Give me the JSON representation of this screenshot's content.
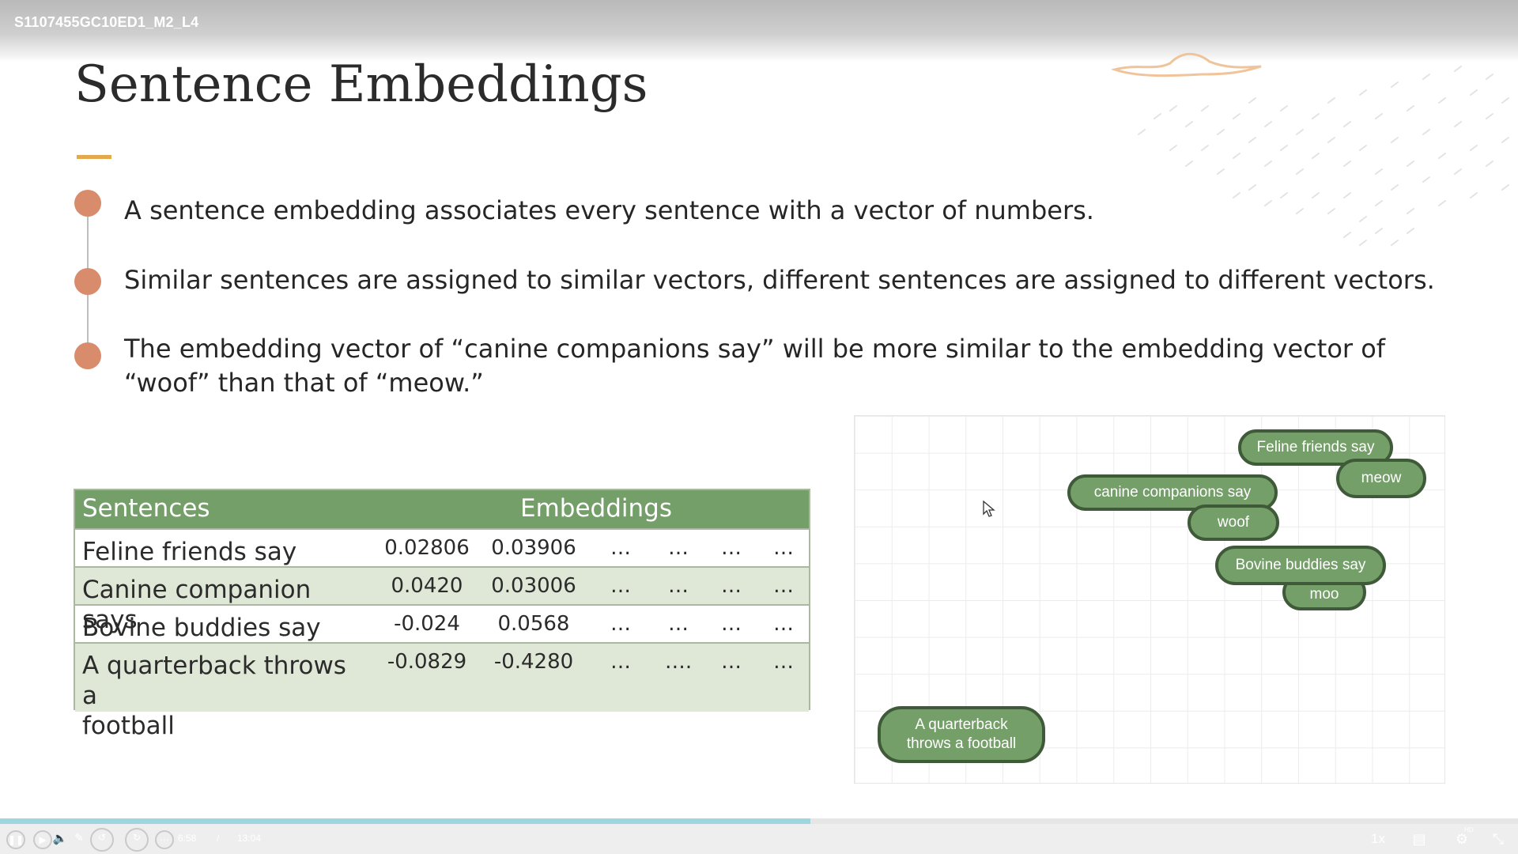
{
  "header": {
    "course_id": "S1107455GC10ED1_M2_L4"
  },
  "slide": {
    "title": "Sentence Embeddings",
    "bullets": [
      {
        "text": "A sentence embedding associates every sentence with a vector of numbers."
      },
      {
        "text": "Similar sentences are assigned to similar vectors, different sentences are assigned to different vectors."
      },
      {
        "line1": "The embedding vector of “canine companions say” will be more similar to the embedding vector of",
        "line2": "“woof” than that of “meow.”"
      }
    ],
    "table": {
      "headers": [
        "Sentences",
        "Embeddings"
      ],
      "rows": [
        {
          "sentence": "Feline friends say",
          "values": [
            "0.02806",
            "0.03906",
            "…",
            "…",
            "…",
            "…"
          ]
        },
        {
          "sentence": "Canine companion says",
          "values": [
            "0.0420",
            "0.03006",
            "…",
            "…",
            "…",
            "…"
          ]
        },
        {
          "sentence": "Bovine buddies say",
          "values": [
            "-0.024",
            "0.0568",
            "…",
            "…",
            "…",
            "…"
          ]
        },
        {
          "sentence_line1": "A quarterback throws a",
          "sentence_line2": "football",
          "values": [
            "-0.0829",
            "-0.4280",
            "…",
            "….",
            "…",
            "…"
          ]
        }
      ]
    },
    "plot": {
      "labels": {
        "feline": "Feline friends say",
        "meow": "meow",
        "canine": "canine companions say",
        "woof": "woof",
        "bovine": "Bovine buddies say",
        "moo": "moo",
        "quarterback_line1": "A quarterback",
        "quarterback_line2": "throws a football"
      },
      "pill_color": "#749f69",
      "pill_border": "#3f5a39"
    }
  },
  "player": {
    "current_time": "6:58",
    "separator": "/",
    "total_time": "13:04",
    "speed": "1x",
    "progress": 0.534,
    "hd_badge": "HD"
  },
  "colors": {
    "accent": "#e4a84f",
    "bullet": "#d88c6b",
    "table_header": "#749f69",
    "table_alt_row": "#dfe8d7"
  }
}
